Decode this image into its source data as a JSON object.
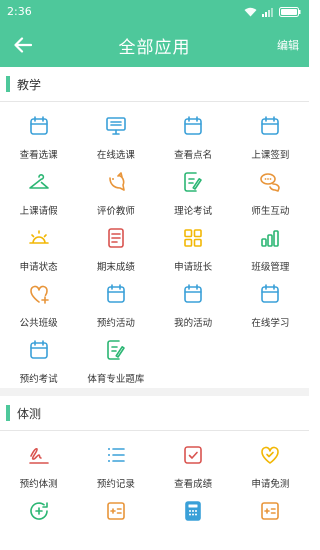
{
  "status_bar": {
    "time": "2:36"
  },
  "header": {
    "title": "全部应用",
    "edit_label": "编辑"
  },
  "colors": {
    "primary": "#4ec89b",
    "blue": "#3aa0d8",
    "orange": "#e8953a",
    "green": "#2bb673",
    "red": "#d9534f",
    "yellow": "#f2b705"
  },
  "sections": [
    {
      "title": "教学",
      "items": [
        {
          "label": "查看选课",
          "icon": "calendar-icon"
        },
        {
          "label": "在线选课",
          "icon": "monitor-icon"
        },
        {
          "label": "查看点名",
          "icon": "calendar-icon"
        },
        {
          "label": "上课签到",
          "icon": "calendar-icon"
        },
        {
          "label": "上课请假",
          "icon": "hanger-icon"
        },
        {
          "label": "评价教师",
          "icon": "bird-icon"
        },
        {
          "label": "理论考试",
          "icon": "exam-pen-icon"
        },
        {
          "label": "师生互动",
          "icon": "chat-bubbles-icon"
        },
        {
          "label": "申请状态",
          "icon": "sun-icon"
        },
        {
          "label": "期末成绩",
          "icon": "document-icon"
        },
        {
          "label": "申请班长",
          "icon": "grid-squares-icon"
        },
        {
          "label": "班级管理",
          "icon": "bar-chart-icon"
        },
        {
          "label": "公共班级",
          "icon": "heart-plus-icon"
        },
        {
          "label": "预约活动",
          "icon": "calendar-icon"
        },
        {
          "label": "我的活动",
          "icon": "calendar-icon"
        },
        {
          "label": "在线学习",
          "icon": "calendar-icon"
        },
        {
          "label": "预约考试",
          "icon": "calendar-icon"
        },
        {
          "label": "体育专业题库",
          "icon": "exam-pen-icon"
        }
      ]
    },
    {
      "title": "体测",
      "items": [
        {
          "label": "预约体测",
          "icon": "signature-icon"
        },
        {
          "label": "预约记录",
          "icon": "list-icon"
        },
        {
          "label": "查看成绩",
          "icon": "check-box-icon"
        },
        {
          "label": "申请免测",
          "icon": "heart-check-icon"
        },
        {
          "label": "",
          "icon": "refresh-plus-icon"
        },
        {
          "label": "",
          "icon": "calculator-box-icon"
        },
        {
          "label": "",
          "icon": "calculator-icon"
        },
        {
          "label": "",
          "icon": "calculator-box-icon"
        }
      ]
    }
  ]
}
